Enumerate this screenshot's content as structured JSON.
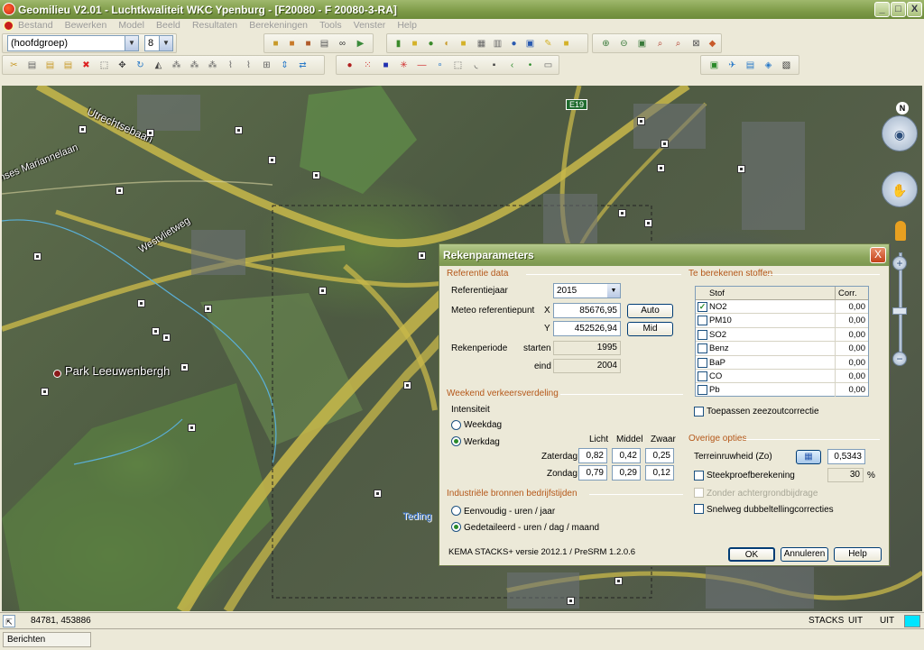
{
  "window": {
    "title": "Geomilieu V2.01 - Luchtkwaliteit WKC Ypenburg - [F20080 - F 20080-3-RA]",
    "controls": [
      "_",
      "□",
      "X"
    ]
  },
  "menu": [
    "Bestand",
    "Bewerken",
    "Model",
    "Beeld",
    "Resultaten",
    "Berekeningen",
    "Tools",
    "Venster",
    "Help"
  ],
  "toolbar": {
    "group_select": "(hoofdgroep)",
    "size_select": "8"
  },
  "map": {
    "labels": {
      "utrechtsebaan": "Utrechtsebaan",
      "mariannelaan": "inses Mariannelaan",
      "westvlietweg": "Westvlietweg",
      "park": "Park Leeuwenbergh",
      "tedinge": "Teding",
      "e19": "E19",
      "north": "N"
    }
  },
  "dialog": {
    "title": "Rekenparameters",
    "close": "X",
    "referentie": {
      "header": "Referentie data",
      "jaar_label": "Referentiejaar",
      "jaar_value": "2015",
      "meteo_label": "Meteo referentiepunt",
      "x_label": "X",
      "x_value": "85676,95",
      "auto_button": "Auto",
      "y_label": "Y",
      "y_value": "452526,94",
      "mid_button": "Mid",
      "periode_label": "Rekenperiode",
      "starten_label": "starten",
      "starten_value": "1995",
      "eind_label": "eind",
      "eind_value": "2004"
    },
    "weekend": {
      "header": "Weekend verkeersverdeling",
      "intensiteit_label": "Intensiteit",
      "weekdag_label": "Weekdag",
      "werkdag_label": "Werkdag",
      "col_licht": "Licht",
      "col_middel": "Middel",
      "col_zwaar": "Zwaar",
      "zaterdag_label": "Zaterdag",
      "zaterdag": [
        "0,82",
        "0,42",
        "0,25"
      ],
      "zondag_label": "Zondag",
      "zondag": [
        "0,79",
        "0,29",
        "0,12"
      ]
    },
    "industrie": {
      "header": "Industriële bronnen bedrijfstijden",
      "eenvoudig_label": "Eenvoudig - uren / jaar",
      "gedetailleerd_label": "Gedetaileerd - uren / dag / maand"
    },
    "stoffen": {
      "header": "Te berekenen stoffen",
      "col_stof": "Stof",
      "col_corr": "Corr.",
      "rows": [
        {
          "name": "NO2",
          "corr": "0,00",
          "checked": true
        },
        {
          "name": "PM10",
          "corr": "0,00",
          "checked": false
        },
        {
          "name": "SO2",
          "corr": "0,00",
          "checked": false
        },
        {
          "name": "Benz",
          "corr": "0,00",
          "checked": false
        },
        {
          "name": "BaP",
          "corr": "0,00",
          "checked": false
        },
        {
          "name": "CO",
          "corr": "0,00",
          "checked": false
        },
        {
          "name": "Pb",
          "corr": "0,00",
          "checked": false
        }
      ],
      "zeezout_label": "Toepassen zeezoutcorrectie"
    },
    "overige": {
      "header": "Overige opties",
      "terrein_label": "Terreinruwheid (Zo)",
      "terrein_value": "0,5343",
      "steekproef_label": "Steekproefberekening",
      "steekproef_value": "30",
      "steekproef_unit": "%",
      "achtergrond_label": "Zonder achtergrondbijdrage",
      "snelweg_label": "Snelweg dubbeltellingcorrecties"
    },
    "version": "KEMA STACKS+ versie 2012.1 / PreSRM 1.2.0.6",
    "ok_button": "OK",
    "annuleren_button": "Annuleren",
    "help_button": "Help"
  },
  "status": {
    "coords": "84781, 453886",
    "stacks": "STACKS",
    "uit1": "UIT",
    "uit2": "UIT",
    "berichten": "Berichten"
  }
}
